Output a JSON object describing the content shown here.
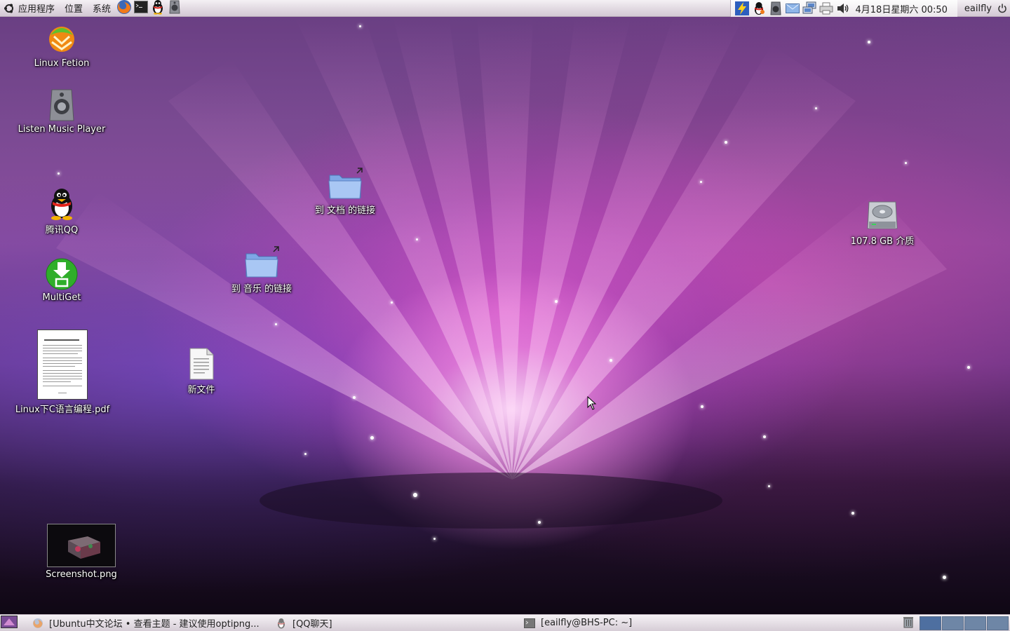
{
  "top_panel": {
    "menus": [
      "应用程序",
      "位置",
      "系统"
    ],
    "launchers": [
      "firefox-icon",
      "terminal-icon",
      "qq-penguin-icon",
      "speaker-icon"
    ],
    "tray_icons": [
      "notify-bolt-icon",
      "qq-tray-icon",
      "music-tray-icon",
      "mail-tray-icon",
      "network-icon",
      "printer-icon",
      "volume-icon"
    ],
    "clock": "4月18日星期六 00:50",
    "user": "eailfly"
  },
  "desktop": {
    "icons": [
      {
        "id": "linux-fetion",
        "label": "Linux Fetion",
        "icon": "fetion-icon"
      },
      {
        "id": "listen-music-player",
        "label": "Listen Music Player",
        "icon": "speaker-icon"
      },
      {
        "id": "tencent-qq",
        "label": "腾讯QQ",
        "icon": "qq-penguin-icon"
      },
      {
        "id": "multiget",
        "label": "MultiGet",
        "icon": "download-icon"
      },
      {
        "id": "linux-c-pdf",
        "label": "Linux下C语言编程.pdf",
        "icon": "pdf-thumbnail-icon"
      },
      {
        "id": "screenshot-png",
        "label": "Screenshot.png",
        "icon": "image-thumbnail-icon"
      },
      {
        "id": "new-file",
        "label": "新文件",
        "icon": "text-file-icon"
      },
      {
        "id": "docs-link",
        "label": "到 文档 的链接",
        "icon": "folder-link-icon"
      },
      {
        "id": "music-link",
        "label": "到 音乐 的链接",
        "icon": "folder-link-icon"
      },
      {
        "id": "drive",
        "label": "107.8 GB 介质",
        "icon": "hard-drive-icon"
      }
    ]
  },
  "bottom_panel": {
    "tasks": [
      {
        "label": "[Ubuntu中文论坛 • 查看主题 - 建议使用optipng...",
        "icon": "firefox-icon"
      },
      {
        "label": "[QQ聊天]",
        "icon": "qq-penguin-icon"
      },
      {
        "label": "[eailfly@BHS-PC: ~]",
        "icon": "terminal-icon"
      }
    ],
    "workspace_count": 4
  }
}
